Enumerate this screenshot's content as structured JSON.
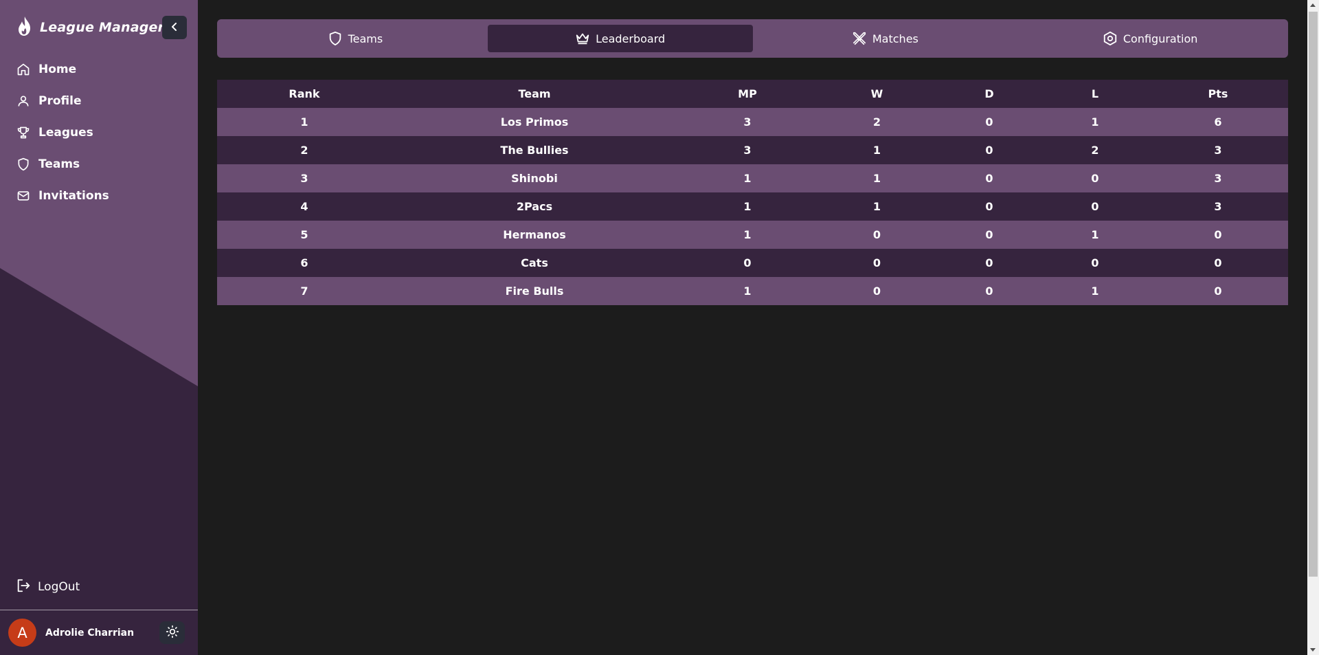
{
  "app": {
    "title": "League Manager"
  },
  "sidebar": {
    "items": [
      {
        "label": "Home",
        "icon": "home-icon"
      },
      {
        "label": "Profile",
        "icon": "user-icon"
      },
      {
        "label": "Leagues",
        "icon": "trophy-icon"
      },
      {
        "label": "Teams",
        "icon": "shield-icon"
      },
      {
        "label": "Invitations",
        "icon": "mail-icon"
      }
    ],
    "logout_label": "LogOut"
  },
  "user": {
    "initial": "A",
    "name": "Adrolie Charrian"
  },
  "tabs": [
    {
      "label": "Teams",
      "icon": "shield-icon"
    },
    {
      "label": "Leaderboard",
      "icon": "crown-icon",
      "active": true
    },
    {
      "label": "Matches",
      "icon": "crossed-swords-icon"
    },
    {
      "label": "Configuration",
      "icon": "hexagon-gear-icon"
    }
  ],
  "leaderboard": {
    "columns": [
      "Rank",
      "Team",
      "MP",
      "W",
      "D",
      "L",
      "Pts"
    ],
    "rows": [
      [
        "1",
        "Los Primos",
        "3",
        "2",
        "0",
        "1",
        "6"
      ],
      [
        "2",
        "The Bullies",
        "3",
        "1",
        "0",
        "2",
        "3"
      ],
      [
        "3",
        "Shinobi",
        "1",
        "1",
        "0",
        "0",
        "3"
      ],
      [
        "4",
        "2Pacs",
        "1",
        "1",
        "0",
        "0",
        "3"
      ],
      [
        "5",
        "Hermanos",
        "1",
        "0",
        "0",
        "1",
        "0"
      ],
      [
        "6",
        "Cats",
        "0",
        "0",
        "0",
        "0",
        "0"
      ],
      [
        "7",
        "Fire Bulls",
        "1",
        "0",
        "0",
        "1",
        "0"
      ]
    ]
  },
  "colors": {
    "sidebar_light": "#6a4d72",
    "sidebar_dark": "#36243e",
    "background": "#1c1c1c",
    "avatar": "#c63c18"
  }
}
